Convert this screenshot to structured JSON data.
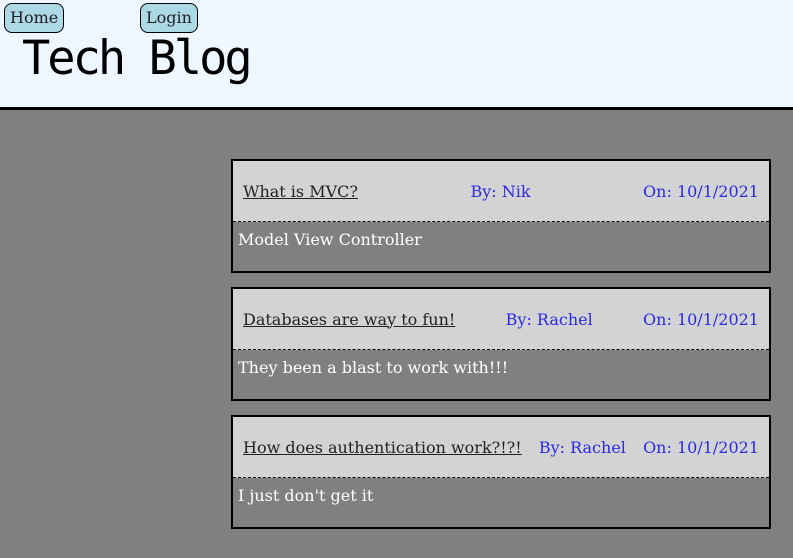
{
  "nav": {
    "home_label": "Home",
    "login_label": "Login"
  },
  "site": {
    "title": "Tech Blog"
  },
  "posts": [
    {
      "title": "What is MVC?",
      "author": "By: Nik",
      "date": "On: 10/1/2021",
      "body": "Model View Controller"
    },
    {
      "title": "Databases are way to fun!",
      "author": "By: Rachel",
      "date": "On: 10/1/2021",
      "body": "They been a blast to work with!!!"
    },
    {
      "title": "How does authentication work?!?!",
      "author": "By: Rachel",
      "date": "On: 10/1/2021",
      "body": "I just don't get it"
    }
  ],
  "colors": {
    "header_bg": "#eef7ff",
    "page_bg": "#808080",
    "button_bg": "#add8e6",
    "post_header_bg": "#d3d3d3",
    "meta_text": "#2a2ae0"
  }
}
